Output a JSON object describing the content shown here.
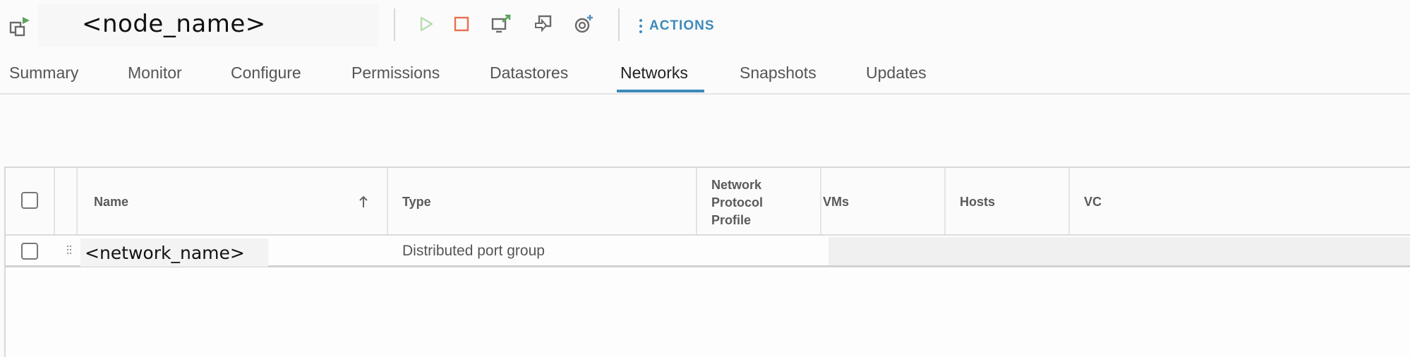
{
  "header": {
    "node_name": "<node_name>",
    "vm_icon": "vm-host-icon",
    "toolbar": [
      {
        "name": "power-on-icon",
        "enabled": false
      },
      {
        "name": "power-off-icon",
        "enabled": true
      },
      {
        "name": "launch-console-icon",
        "enabled": true
      },
      {
        "name": "migrate-icon",
        "enabled": true
      },
      {
        "name": "snapshot-icon",
        "enabled": true
      }
    ],
    "actions_label": "ACTIONS"
  },
  "tabs": [
    {
      "label": "Summary"
    },
    {
      "label": "Monitor"
    },
    {
      "label": "Configure"
    },
    {
      "label": "Permissions"
    },
    {
      "label": "Datastores"
    },
    {
      "label": "Networks",
      "active": true
    },
    {
      "label": "Snapshots"
    },
    {
      "label": "Updates"
    }
  ],
  "grid": {
    "columns": {
      "name": "Name",
      "type": "Type",
      "npp_line1": "Network",
      "npp_line2": "Protocol",
      "npp_line3": "Profile",
      "vms": "VMs",
      "hosts": "Hosts",
      "vc": "VC"
    },
    "sort": {
      "column": "Name",
      "direction": "ascending"
    },
    "rows": [
      {
        "name": "<network_name>",
        "type": "Distributed port group"
      }
    ]
  },
  "colors": {
    "accent": "#3d8ab8",
    "power_off": "#e8704f",
    "power_on_disabled": "#b9dcb0"
  }
}
